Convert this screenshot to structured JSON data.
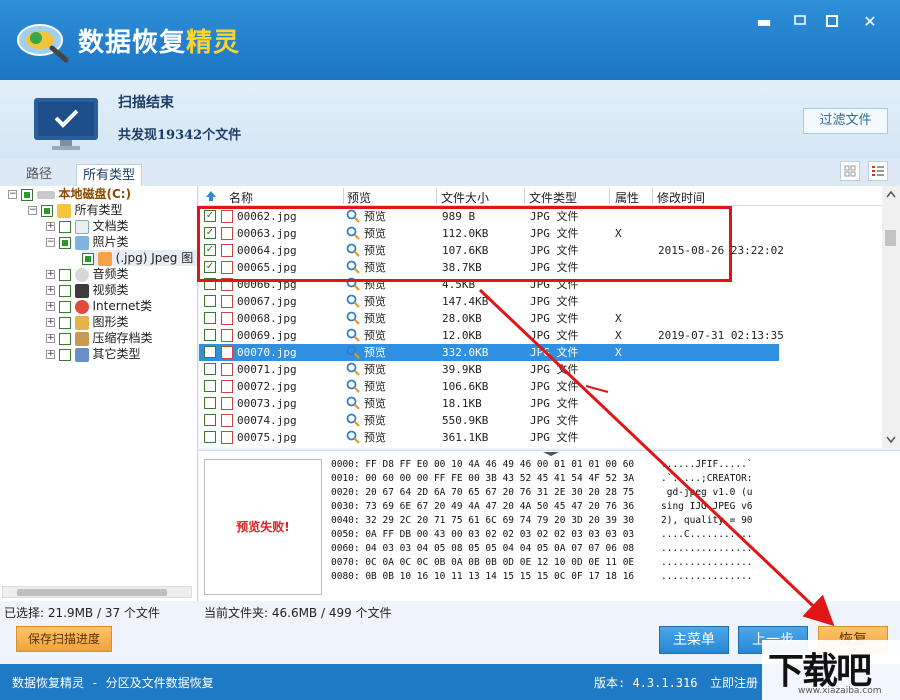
{
  "app": {
    "title_part1": "数据恢复",
    "title_part2": "精灵",
    "minimize": "▬",
    "maximize": "☐",
    "close": "✕"
  },
  "status": {
    "title": "扫描结束",
    "count_text": "共发现19342个文件",
    "filter_button": "过滤文件"
  },
  "tabs": [
    "路径",
    "所有类型"
  ],
  "tree": {
    "root": "本地磁盘(C:)",
    "all_types": "所有类型",
    "items": [
      {
        "label": "文档类"
      },
      {
        "label": "照片类"
      },
      {
        "label": "(.jpg) Jpeg 图"
      },
      {
        "label": "音频类"
      },
      {
        "label": "视频类"
      },
      {
        "label": "Internet类"
      },
      {
        "label": "图形类"
      },
      {
        "label": "压缩存档类"
      },
      {
        "label": "其它类型"
      }
    ]
  },
  "table": {
    "headers": [
      "名称",
      "预览",
      "文件大小",
      "文件类型",
      "属性",
      "修改时间"
    ],
    "rows": [
      {
        "name": "00062.jpg",
        "preview": "预览",
        "size": "989 B",
        "type": "JPG 文件",
        "attr": "",
        "mtime": "",
        "checked": true
      },
      {
        "name": "00063.jpg",
        "preview": "预览",
        "size": "112.0KB",
        "type": "JPG 文件",
        "attr": "X",
        "mtime": "",
        "checked": true
      },
      {
        "name": "00064.jpg",
        "preview": "预览",
        "size": "107.6KB",
        "type": "JPG 文件",
        "attr": "",
        "mtime": "2015-08-26 23:22:02",
        "checked": true
      },
      {
        "name": "00065.jpg",
        "preview": "预览",
        "size": "38.7KB",
        "type": "JPG 文件",
        "attr": "",
        "mtime": "",
        "checked": true
      },
      {
        "name": "00066.jpg",
        "preview": "预览",
        "size": "4.5KB",
        "type": "JPG 文件",
        "attr": "",
        "mtime": "",
        "checked": false
      },
      {
        "name": "00067.jpg",
        "preview": "预览",
        "size": "147.4KB",
        "type": "JPG 文件",
        "attr": "",
        "mtime": "",
        "checked": false
      },
      {
        "name": "00068.jpg",
        "preview": "预览",
        "size": "28.0KB",
        "type": "JPG 文件",
        "attr": "X",
        "mtime": "",
        "checked": false
      },
      {
        "name": "00069.jpg",
        "preview": "预览",
        "size": "12.0KB",
        "type": "JPG 文件",
        "attr": "X",
        "mtime": "2019-07-31 02:13:35",
        "checked": false
      },
      {
        "name": "00070.jpg",
        "preview": "预览",
        "size": "332.0KB",
        "type": "JPG 文件",
        "attr": "X",
        "mtime": "",
        "checked": false,
        "selected": true
      },
      {
        "name": "00071.jpg",
        "preview": "预览",
        "size": "39.9KB",
        "type": "JPG 文件",
        "attr": "",
        "mtime": "",
        "checked": false
      },
      {
        "name": "00072.jpg",
        "preview": "预览",
        "size": "106.6KB",
        "type": "JPG 文件",
        "attr": "",
        "mtime": "",
        "checked": false
      },
      {
        "name": "00073.jpg",
        "preview": "预览",
        "size": "18.1KB",
        "type": "JPG 文件",
        "attr": "",
        "mtime": "",
        "checked": false
      },
      {
        "name": "00074.jpg",
        "preview": "预览",
        "size": "550.9KB",
        "type": "JPG 文件",
        "attr": "",
        "mtime": "",
        "checked": false
      },
      {
        "name": "00075.jpg",
        "preview": "预览",
        "size": "361.1KB",
        "type": "JPG 文件",
        "attr": "",
        "mtime": "",
        "checked": false
      }
    ]
  },
  "preview": {
    "fail_text": "预览失败!",
    "hex_lines": [
      "0000: FF D8 FF E0 00 10 4A 46 49 46 00 01 01 01 00 60",
      "0010: 00 60 00 00 FF FE 00 3B 43 52 45 41 54 4F 52 3A",
      "0020: 20 67 64 2D 6A 70 65 67 20 76 31 2E 30 20 28 75",
      "0030: 73 69 6E 67 20 49 4A 47 20 4A 50 45 47 20 76 36",
      "0040: 32 29 2C 20 71 75 61 6C 69 74 79 20 3D 20 39 30",
      "0050: 0A FF DB 00 43 00 03 02 02 03 02 02 03 03 03 03",
      "0060: 04 03 03 04 05 08 05 05 04 04 05 0A 07 07 06 08",
      "0070: 0C 0A 0C 0C 0B 0A 0B 0B 0D 0E 12 10 0D 0E 11 0E",
      "0080: 0B 0B 10 16 10 11 13 14 15 15 15 0C 0F 17 18 16"
    ],
    "ascii_lines": [
      "......JFIF.....`",
      ".`.....;CREATOR:",
      " gd-jpeg v1.0 (u",
      "sing IJG JPEG v6",
      "2), quality = 90",
      "....C...........",
      "................",
      "................",
      "................"
    ]
  },
  "info": {
    "selected": "已选择: 21.9MB / 37 个文件",
    "current_folder": "当前文件夹: 46.6MB / 499 个文件"
  },
  "buttons": {
    "save_progress": "保存扫描进度",
    "main_menu": "主菜单",
    "prev_step": "上一步",
    "recover": "恢复"
  },
  "footer": {
    "text": "数据恢复精灵 - 分区及文件数据恢复",
    "version": "版本: 4.3.1.316",
    "register": "立即注册"
  },
  "watermark": {
    "text": "下载吧",
    "url": "www.xiazaiba.com"
  },
  "colors": {
    "titlebar": "#1b74c4",
    "selected_row": "#2f8fe0",
    "annotation": "#e01515",
    "button_blue": "#2b86d2",
    "button_orange": "#f0a43e"
  }
}
